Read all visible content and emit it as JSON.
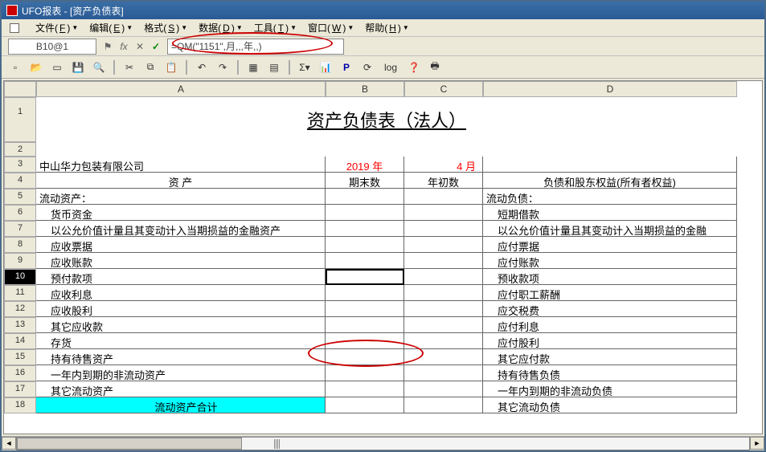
{
  "title": "UFO报表 - [资产负债表]",
  "menus": [
    {
      "label": "文件",
      "key": "F"
    },
    {
      "label": "编辑",
      "key": "E"
    },
    {
      "label": "格式",
      "key": "S"
    },
    {
      "label": "数据",
      "key": "D"
    },
    {
      "label": "工具",
      "key": "T"
    },
    {
      "label": "窗口",
      "key": "W"
    },
    {
      "label": "帮助",
      "key": "H"
    }
  ],
  "cell_ref": "B10@1",
  "formula": "=QM(\"1151\",月,,,年,,)",
  "columns": [
    "A",
    "B",
    "C",
    "D"
  ],
  "sheet_title": "资产负债表（法人）",
  "row3": {
    "a": "中山华力包装有限公司",
    "b": "2019 年",
    "c": "4 月",
    "d": ""
  },
  "row4": {
    "a": "资    产",
    "b": "期末数",
    "c": "年初数",
    "d": "负债和股东权益(所有者权益)"
  },
  "rows": [
    {
      "n": 5,
      "a": "流动资产：",
      "d": "流动负债：",
      "ai": false
    },
    {
      "n": 6,
      "a": "货币资金",
      "d": "短期借款",
      "ai": true
    },
    {
      "n": 7,
      "a": "以公允价值计量且其变动计入当期损益的金融资产",
      "d": "以公允价值计量且其变动计入当期损益的金融",
      "ai": true
    },
    {
      "n": 8,
      "a": "应收票据",
      "d": "应付票据",
      "ai": true
    },
    {
      "n": 9,
      "a": "应收账款",
      "d": "应付账款",
      "ai": true
    },
    {
      "n": 10,
      "a": "预付款项",
      "d": "预收款项",
      "ai": true,
      "sel": true
    },
    {
      "n": 11,
      "a": "应收利息",
      "d": "应付职工薪酬",
      "ai": true
    },
    {
      "n": 12,
      "a": "应收股利",
      "d": "应交税费",
      "ai": true
    },
    {
      "n": 13,
      "a": "其它应收款",
      "d": "应付利息",
      "ai": true
    },
    {
      "n": 14,
      "a": "存货",
      "d": "应付股利",
      "ai": true
    },
    {
      "n": 15,
      "a": "持有待售资产",
      "d": "其它应付款",
      "ai": true
    },
    {
      "n": 16,
      "a": "一年内到期的非流动资产",
      "d": "持有待售负债",
      "ai": true
    },
    {
      "n": 17,
      "a": "其它流动资产",
      "d": "一年内到期的非流动负债",
      "ai": true
    },
    {
      "n": 18,
      "a": "流动资产合计",
      "d": "其它流动负债",
      "ai": true,
      "cyan": true
    }
  ],
  "chart_data": {
    "type": "table",
    "title": "资产负债表（法人）",
    "company": "中山华力包装有限公司",
    "period": {
      "year": 2019,
      "month": 4
    },
    "columns": [
      "资 产",
      "期末数",
      "年初数",
      "负债和股东权益(所有者权益)"
    ],
    "rows": [
      [
        "流动资产：",
        "",
        "",
        "流动负债："
      ],
      [
        "货币资金",
        "",
        "",
        "短期借款"
      ],
      [
        "以公允价值计量且其变动计入当期损益的金融资产",
        "",
        "",
        "以公允价值计量且其变动计入当期损益的金融"
      ],
      [
        "应收票据",
        "",
        "",
        "应付票据"
      ],
      [
        "应收账款",
        "",
        "",
        "应付账款"
      ],
      [
        "预付款项",
        "",
        "",
        "预收款项"
      ],
      [
        "应收利息",
        "",
        "",
        "应付职工薪酬"
      ],
      [
        "应收股利",
        "",
        "",
        "应交税费"
      ],
      [
        "其它应收款",
        "",
        "",
        "应付利息"
      ],
      [
        "存货",
        "",
        "",
        "应付股利"
      ],
      [
        "持有待售资产",
        "",
        "",
        "其它应付款"
      ],
      [
        "一年内到期的非流动资产",
        "",
        "",
        "持有待售负债"
      ],
      [
        "其它流动资产",
        "",
        "",
        "一年内到期的非流动负债"
      ],
      [
        "流动资产合计",
        "",
        "",
        "其它流动负债"
      ]
    ]
  }
}
